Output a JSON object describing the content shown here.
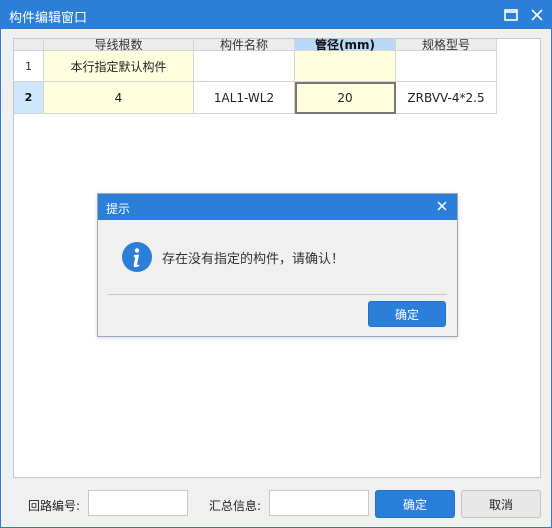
{
  "window": {
    "title": "构件编辑窗口"
  },
  "table": {
    "columns": [
      {
        "label": "",
        "selected": false
      },
      {
        "label": "导线根数",
        "selected": false
      },
      {
        "label": "构件名称",
        "selected": false
      },
      {
        "label": "管径(mm)",
        "selected": true
      },
      {
        "label": "规格型号",
        "selected": false
      }
    ],
    "rows": [
      {
        "num": "1",
        "cells": [
          "本行指定默认构件",
          "",
          "",
          ""
        ]
      },
      {
        "num": "2",
        "cells": [
          "4",
          "1AL1-WL2",
          "20",
          "ZRBVV-4*2.5"
        ]
      }
    ]
  },
  "dialog": {
    "title": "提示",
    "message": "存在没有指定的构件，请确认！",
    "ok_label": "确定"
  },
  "footer": {
    "circuit_label": "回路编号:",
    "circuit_value": "",
    "summary_label": "汇总信息:",
    "summary_value": "",
    "ok_label": "确定",
    "cancel_label": "取消"
  },
  "colors": {
    "titlebar": "#2b7fd9",
    "selected_header": "#b8d8f8",
    "highlight_cell": "#ffffe0"
  }
}
